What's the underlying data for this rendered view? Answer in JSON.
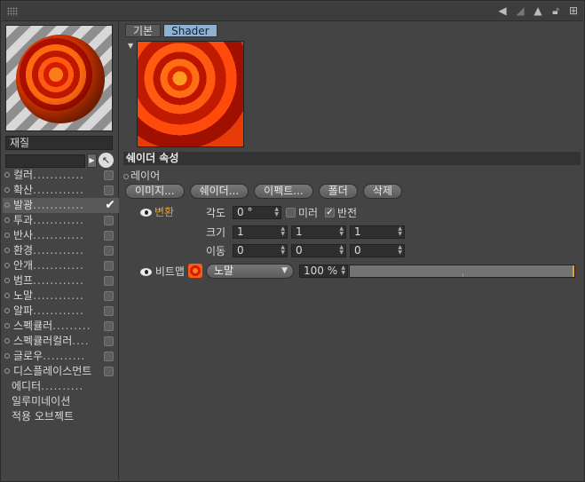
{
  "titlebar": {
    "icons": [
      "back-arrow-icon",
      "forward-arrow-icon",
      "up-arrow-icon",
      "lock-icon",
      "new-window-icon"
    ]
  },
  "material": {
    "name": "재질",
    "search_value": ""
  },
  "channels": [
    {
      "label": "컬러",
      "dots": "............",
      "checked": false
    },
    {
      "label": "확산",
      "dots": "............",
      "checked": false
    },
    {
      "label": "발광",
      "dots": "............",
      "checked": true,
      "selected": true
    },
    {
      "label": "투과",
      "dots": "............",
      "checked": false
    },
    {
      "label": "반사",
      "dots": "............",
      "checked": false
    },
    {
      "label": "환경",
      "dots": "............",
      "checked": false
    },
    {
      "label": "안개",
      "dots": "............",
      "checked": false
    },
    {
      "label": "범프",
      "dots": "............",
      "checked": false
    },
    {
      "label": "노말",
      "dots": "............",
      "checked": false
    },
    {
      "label": "알파",
      "dots": "............",
      "checked": false
    },
    {
      "label": "스펙큘러",
      "dots": ".........",
      "checked": false
    },
    {
      "label": "스펙큘러컬러",
      "dots": "....",
      "checked": false
    },
    {
      "label": "글로우",
      "dots": "..........",
      "checked": false
    },
    {
      "label": "디스플레이스먼트",
      "dots": "",
      "checked": false
    }
  ],
  "extra_items": [
    {
      "label": "에디터",
      "dots": ".........."
    },
    {
      "label": "일루미네이션",
      "dots": ""
    },
    {
      "label": "적용 오브젝트",
      "dots": ""
    }
  ],
  "tabs": [
    {
      "label": "기본",
      "active": false
    },
    {
      "label": "Shader",
      "active": true
    }
  ],
  "shader": {
    "section_title": "쉐이더 속성",
    "layer_label": "레이어",
    "buttons": [
      "이미지...",
      "쉐이더...",
      "이펙트...",
      "폴더",
      "삭제"
    ],
    "transform_label": "변환",
    "angle_label": "각도",
    "angle_value": "0 °",
    "mirror_label": "미러",
    "mirror_checked": false,
    "invert_label": "반전",
    "invert_checked": true,
    "size_label": "크기",
    "size_values": [
      "1",
      "1",
      "1"
    ],
    "move_label": "이동",
    "move_values": [
      "0",
      "0",
      "0"
    ],
    "bitmap_label": "비트맵",
    "blend_mode": "노말",
    "opacity": "100 %",
    "opacity_fraction": 1.0
  }
}
